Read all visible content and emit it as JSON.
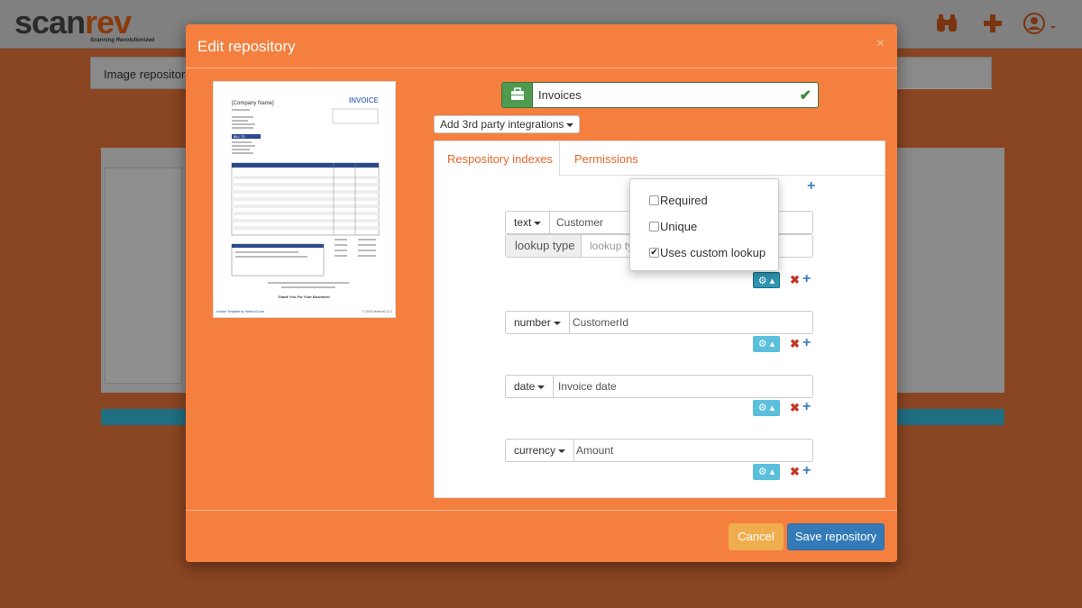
{
  "app": {
    "logo_scan": "scan",
    "logo_rev": "rev",
    "tagline": "Scanning Revolutionized"
  },
  "header_icons": [
    "binoculars-icon",
    "plus-icon",
    "user-icon"
  ],
  "background": {
    "card_title": "Image repositorie"
  },
  "modal": {
    "title": "Edit repository",
    "close": "×",
    "repository_name": "Invoices",
    "integrations_label": "Add 3rd party integrations",
    "tabs": [
      {
        "label": "Respository indexes"
      },
      {
        "label": "Permissions"
      }
    ],
    "indexes": [
      {
        "type": "text",
        "name": "Customer"
      },
      {
        "type": "number",
        "name": "CustomerId"
      },
      {
        "type": "date",
        "name": "Invoice date"
      },
      {
        "type": "currency",
        "name": "Amount"
      }
    ],
    "lookup": {
      "label": "lookup type",
      "placeholder": "lookup ty"
    },
    "options": [
      {
        "label": "Required",
        "checked": false
      },
      {
        "label": "Unique",
        "checked": false
      },
      {
        "label": "Uses custom lookup",
        "checked": true
      }
    ],
    "buttons": {
      "cancel": "Cancel",
      "save": "Save repository"
    }
  },
  "invoice_thumb": {
    "company": "[Company Name]",
    "heading": "INVOICE",
    "bill_to": "BILL TO",
    "footer_left": "Invoice Template by Vertex42.com",
    "footer_right": "© 2018 Vertex42 LLC",
    "thanks": "Thank You For Your Business!"
  },
  "colors": {
    "modal": "#f47f3f",
    "accent_text": "#e4692b",
    "primary": "#337ab7",
    "warning": "#f0ad4e",
    "info": "#5bc0de"
  }
}
